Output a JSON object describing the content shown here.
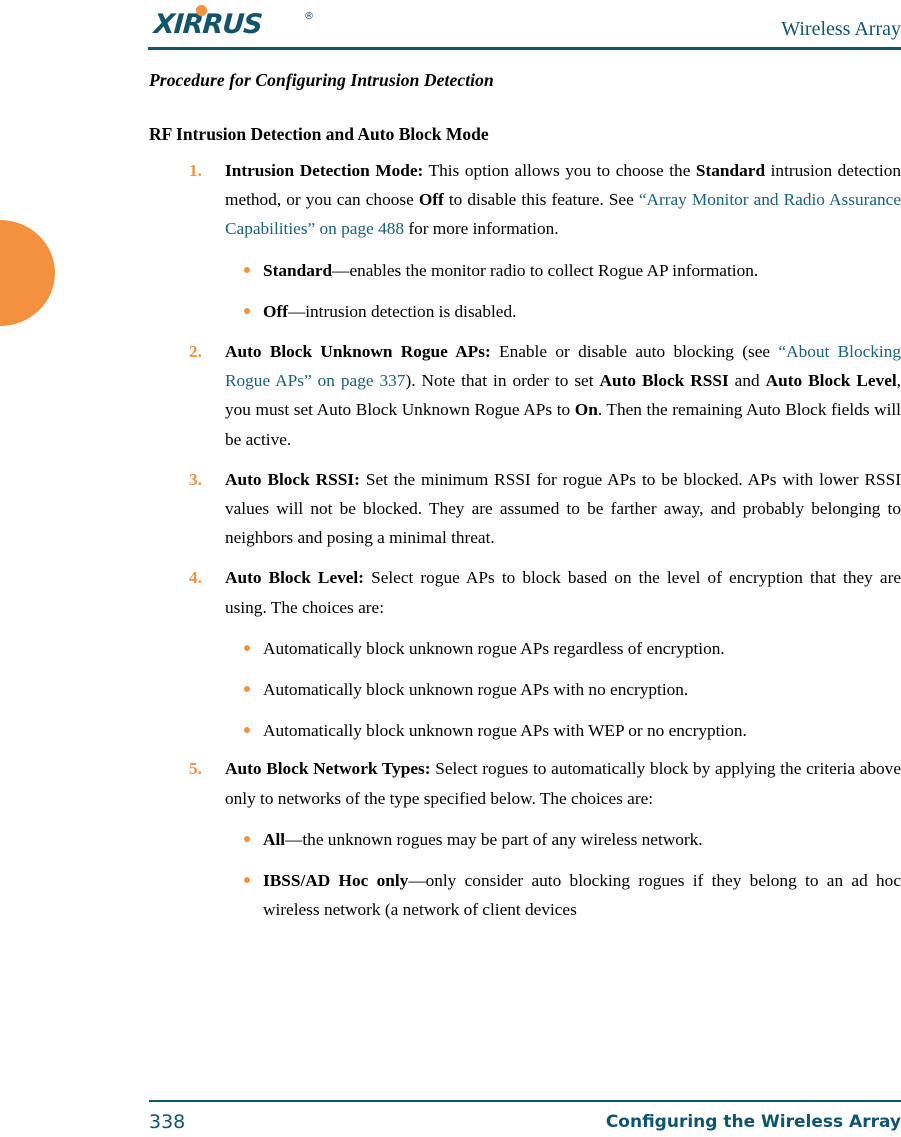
{
  "colors": {
    "brand_teal": "#0E5571",
    "accent_orange": "#F3913E",
    "link_teal": "#186380",
    "logo_teal": "#12556B"
  },
  "header": {
    "logo_text": "XIRRUS",
    "logo_registered": "®",
    "title": "Wireless Array"
  },
  "content": {
    "procedure_heading": "Procedure for Configuring Intrusion Detection",
    "section_heading": "RF Intrusion Detection and Auto Block Mode",
    "items": [
      {
        "number": "1.",
        "term": "Intrusion Detection Mode:",
        "t1": " This option allows you to choose the ",
        "b1": "Standard",
        "t2": " intrusion detection method, or you can choose ",
        "b2": "Off",
        "t3": " to disable this feature. See ",
        "link": "“Array Monitor and Radio Assurance Capabilities” on page 488",
        "t4": " for more information."
      },
      {
        "number": "2.",
        "term": "Auto Block Unknown Rogue APs:",
        "t1": " Enable or disable auto blocking (see ",
        "link": "“About Blocking Rogue APs” on page 337",
        "t2": "). Note that in order to set ",
        "b1": "Auto Block RSSI",
        "t3": " and ",
        "b2": "Auto Block Level",
        "t4": ", you must set Auto Block Unknown Rogue APs to ",
        "b3": "On",
        "t5": ". Then the remaining Auto Block fields will be active."
      },
      {
        "number": "3.",
        "term": "Auto Block RSSI:",
        "t1": " Set the minimum RSSI for rogue APs to be blocked. APs with lower RSSI values will not be blocked. They are assumed to be farther away, and probably belonging to neighbors and posing a minimal threat."
      },
      {
        "number": "4.",
        "term": "Auto Block Level:",
        "t1": " Select rogue APs to block based on the level of encryption that they are using. The choices are:"
      },
      {
        "number": "5.",
        "term": "Auto Block Network Types:",
        "t1": " Select rogues to automatically block by applying the criteria above only to networks of the type specified below. The choices are:"
      }
    ],
    "bullets_mode": [
      {
        "term": "Standard",
        "text": "—enables the monitor radio to collect Rogue AP information."
      },
      {
        "term": "Off",
        "text": "—intrusion detection is disabled."
      }
    ],
    "bullets_level": [
      "Automatically block unknown rogue APs regardless of encryption.",
      "Automatically block unknown rogue APs with no encryption.",
      "Automatically block unknown rogue APs with WEP or no encryption."
    ],
    "bullets_network": [
      {
        "term": "All",
        "text": "—the unknown rogues may be part of any wireless network."
      },
      {
        "term": "IBSS/AD Hoc only",
        "text": "—only consider auto blocking rogues if they belong to an ad hoc wireless network (a network of client devices"
      }
    ]
  },
  "footer": {
    "page_number": "338",
    "title": "Configuring the Wireless Array"
  }
}
